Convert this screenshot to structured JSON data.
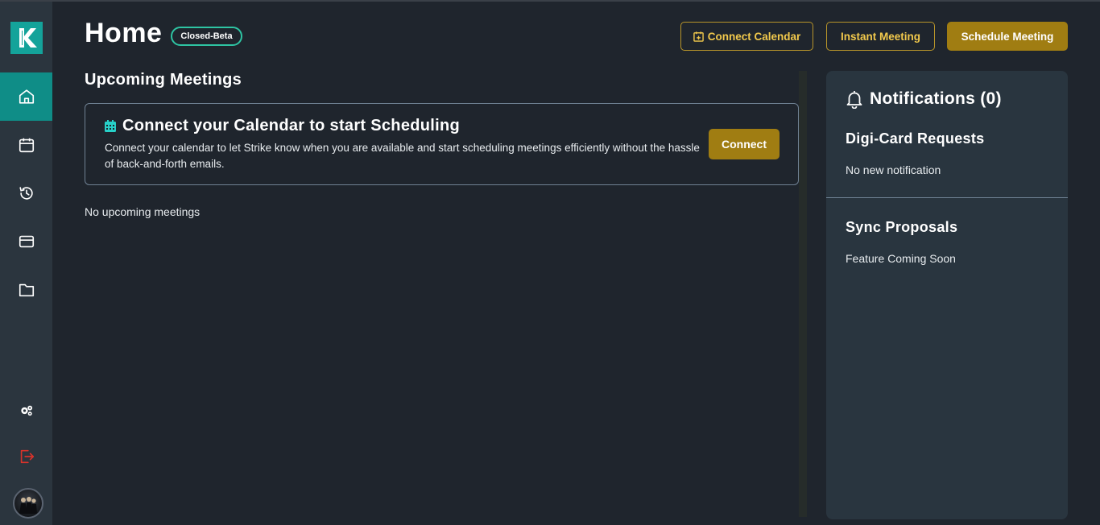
{
  "header": {
    "title": "Home",
    "badge": "Closed-Beta",
    "buttons": {
      "connect_calendar": "Connect Calendar",
      "instant_meeting": "Instant Meeting",
      "schedule_meeting": "Schedule Meeting"
    }
  },
  "sidebar": {
    "logo_letter": "K",
    "items": [
      {
        "name": "home",
        "icon": "home-icon",
        "active": true
      },
      {
        "name": "calendar",
        "icon": "calendar-icon",
        "active": false
      },
      {
        "name": "history",
        "icon": "history-icon",
        "active": false
      },
      {
        "name": "cards",
        "icon": "card-icon",
        "active": false
      },
      {
        "name": "files",
        "icon": "folder-icon",
        "active": false
      }
    ],
    "bottom": [
      {
        "name": "settings",
        "icon": "gears-icon"
      },
      {
        "name": "logout",
        "icon": "logout-icon"
      }
    ]
  },
  "main": {
    "section_title": "Upcoming Meetings",
    "connect_card": {
      "title": "Connect your Calendar to start Scheduling",
      "description": "Connect your calendar to let Strike know when you are available and start scheduling meetings efficiently without the hassle of back-and-forth emails.",
      "button": "Connect"
    },
    "empty_message": "No upcoming meetings"
  },
  "notifications": {
    "title": "Notifications (0)",
    "sections": [
      {
        "title": "Digi-Card Requests",
        "message": "No new notification"
      },
      {
        "title": "Sync Proposals",
        "message": "Feature Coming Soon"
      }
    ]
  },
  "colors": {
    "background": "#1f252d",
    "sidebar": "#2b353e",
    "accent_teal": "#0f8d87",
    "gold": "#a07d12",
    "gold_text": "#f2c94c",
    "panel": "#29353f",
    "badge_border": "#2ec4a3",
    "logout_red": "#d9332b"
  }
}
